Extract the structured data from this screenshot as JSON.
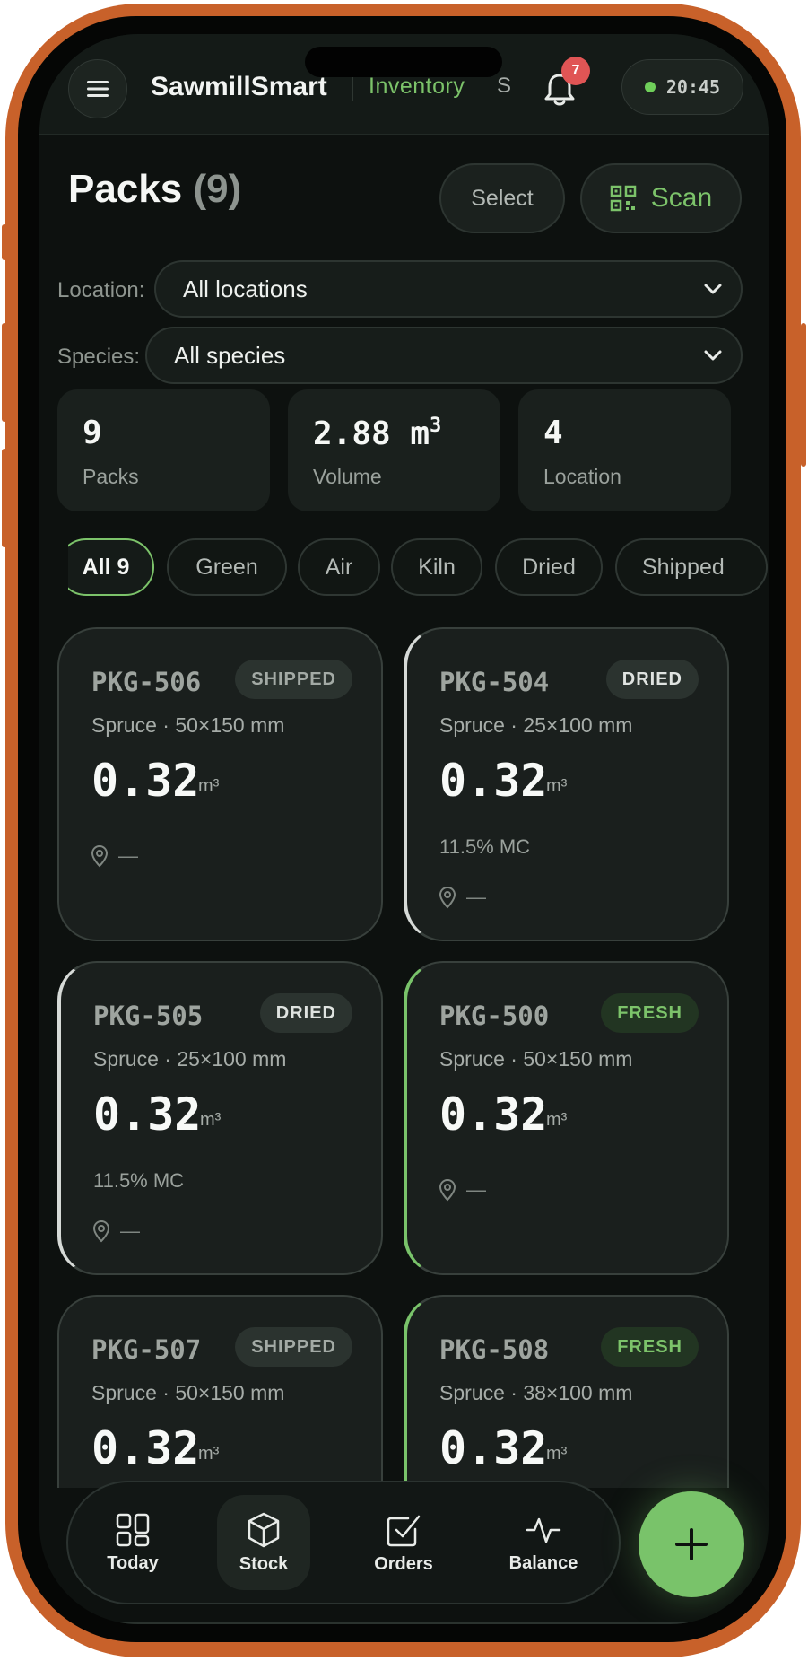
{
  "header": {
    "brand": "SawmillSmart",
    "section": "Inventory",
    "user_initial": "S",
    "notifications_count": "7",
    "time": "20:45"
  },
  "page": {
    "title": "Packs",
    "count": "(9)",
    "select_label": "Select",
    "scan_label": "Scan"
  },
  "filters": {
    "location_label": "Location:",
    "location_value": "All locations",
    "species_label": "Species:",
    "species_value": "All species"
  },
  "stats": [
    {
      "value": "9",
      "label": "Packs"
    },
    {
      "value": "2.88 m",
      "unit_sup": "3",
      "label": "Volume"
    },
    {
      "value": "4",
      "label": "Location"
    }
  ],
  "chips": [
    {
      "label": "All 9",
      "active": true
    },
    {
      "label": "Green"
    },
    {
      "label": "Air"
    },
    {
      "label": "Kiln"
    },
    {
      "label": "Dried"
    },
    {
      "label": "Shipped"
    }
  ],
  "packs": [
    {
      "id": "PKG-506",
      "status": "SHIPPED",
      "spec": "Spruce · 50×150 mm",
      "volume": "0.32",
      "unit": "m³",
      "moisture": "",
      "location": "—"
    },
    {
      "id": "PKG-504",
      "status": "DRIED",
      "spec": "Spruce · 25×100 mm",
      "volume": "0.32",
      "unit": "m³",
      "moisture": "11.5% MC",
      "location": "—"
    },
    {
      "id": "PKG-505",
      "status": "DRIED",
      "spec": "Spruce · 25×100 mm",
      "volume": "0.32",
      "unit": "m³",
      "moisture": "11.5% MC",
      "location": "—"
    },
    {
      "id": "PKG-500",
      "status": "FRESH",
      "spec": "Spruce · 50×150 mm",
      "volume": "0.32",
      "unit": "m³",
      "moisture": "",
      "location": "—"
    },
    {
      "id": "PKG-507",
      "status": "SHIPPED",
      "spec": "Spruce · 50×150 mm",
      "volume": "0.32",
      "unit": "m³",
      "moisture": "",
      "location": ""
    },
    {
      "id": "PKG-508",
      "status": "FRESH",
      "spec": "Spruce · 38×100 mm",
      "volume": "0.32",
      "unit": "m³",
      "moisture": "",
      "location": ""
    }
  ],
  "nav": [
    {
      "label": "Today",
      "icon": "grid-icon"
    },
    {
      "label": "Stock",
      "icon": "box-icon",
      "active": true
    },
    {
      "label": "Orders",
      "icon": "checkbox-icon"
    },
    {
      "label": "Balance",
      "icon": "pulse-icon"
    }
  ],
  "colors": {
    "accent": "#7cc36a",
    "frame": "#c8612a",
    "background": "#0d110f"
  }
}
